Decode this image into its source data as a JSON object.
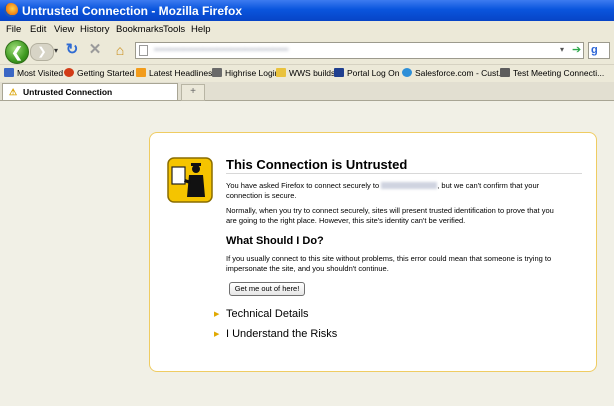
{
  "window": {
    "title": "Untrusted Connection - Mozilla Firefox"
  },
  "menu": [
    "File",
    "Edit",
    "View",
    "History",
    "Bookmarks",
    "Tools",
    "Help"
  ],
  "bookmarks": [
    {
      "label": "Most Visited",
      "icon": "most-visited-icon",
      "color": "#3b67c4"
    },
    {
      "label": "Getting Started",
      "icon": "firefox-icon",
      "color": "#d23b17"
    },
    {
      "label": "Latest Headlines",
      "icon": "rss-icon",
      "color": "#f29c1b"
    },
    {
      "label": "Highrise Login",
      "icon": "highrise-icon",
      "color": "#6a6a6a"
    },
    {
      "label": "WWS builds",
      "icon": "folder-icon",
      "color": "#e9c23d"
    },
    {
      "label": "Portal Log On",
      "icon": "w-icon",
      "color": "#1f3f8f"
    },
    {
      "label": "Salesforce.com - Cust...",
      "icon": "cloud-icon",
      "color": "#2d8fd8"
    },
    {
      "label": "Test Meeting Connecti...",
      "icon": "meeting-icon",
      "color": "#5d5d5d"
    }
  ],
  "tab": {
    "label": "Untrusted Connection",
    "icon": "warning-icon"
  },
  "error": {
    "title": "This Connection is Untrusted",
    "p1_before": "You have asked Firefox to connect securely to",
    "p1_after": ", but we can't confirm that your",
    "p1_line2": "connection is secure.",
    "p2_line1": "Normally, when you try to connect securely, sites will present trusted identification to prove that you",
    "p2_line2": "are going to the right place. However, this site's identity can't be verified.",
    "heading": "What Should I Do?",
    "p3_line1": "If you usually connect to this site without problems, this error could mean that someone is trying to",
    "p3_line2": "impersonate the site, and you shouldn't continue.",
    "button": "Get me out of here!",
    "expanders": [
      "Technical Details",
      "I Understand the Risks"
    ]
  },
  "colors": {
    "accent": "#0a55dd",
    "box_border": "#efcc62",
    "triangle": "#e0a800"
  }
}
